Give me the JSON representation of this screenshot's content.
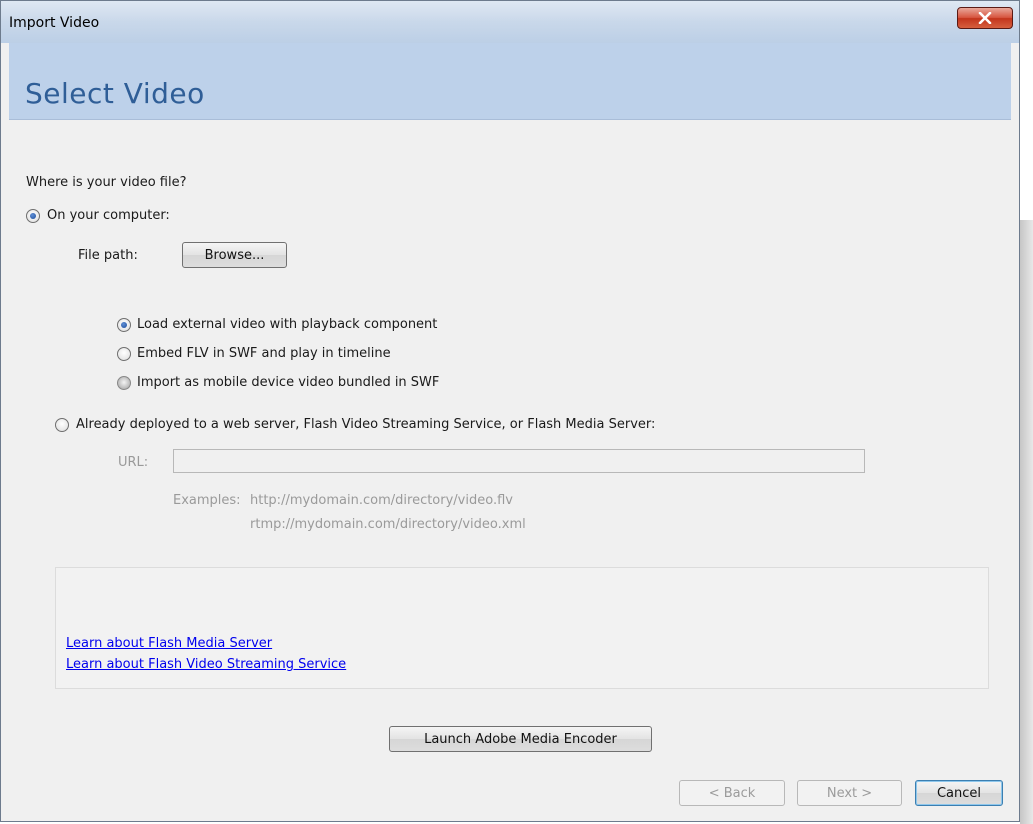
{
  "window": {
    "title": "Import Video"
  },
  "header": {
    "title": "Select Video"
  },
  "form": {
    "question": "Where is your video file?",
    "on_computer_label": "On your computer:",
    "file_path_label": "File path:",
    "browse_label": "Browse...",
    "options": [
      {
        "label": "Load external video with playback component",
        "selected": true
      },
      {
        "label": "Embed FLV in SWF and play in timeline",
        "selected": false
      },
      {
        "label": "Import as mobile device video bundled in SWF",
        "selected": false
      }
    ],
    "deployed_label": "Already deployed to a web server, Flash Video Streaming Service, or Flash Media Server:",
    "url_label": "URL:",
    "url_value": "",
    "examples_label": "Examples:",
    "example_1": "http://mydomain.com/directory/video.flv",
    "example_2": "rtmp://mydomain.com/directory/video.xml"
  },
  "links": {
    "flash_media_server": "Learn about Flash Media Server",
    "flash_video_streaming": "Learn about Flash Video Streaming Service"
  },
  "buttons": {
    "launch_encoder": "Launch Adobe Media Encoder",
    "back": "< Back",
    "next": "Next >",
    "cancel": "Cancel"
  },
  "icons": {
    "close": "close-icon"
  },
  "colors": {
    "header_band": "#bdd1ea",
    "header_text": "#2f5e97",
    "close_button": "#c3341c",
    "link": "#0000ee"
  }
}
